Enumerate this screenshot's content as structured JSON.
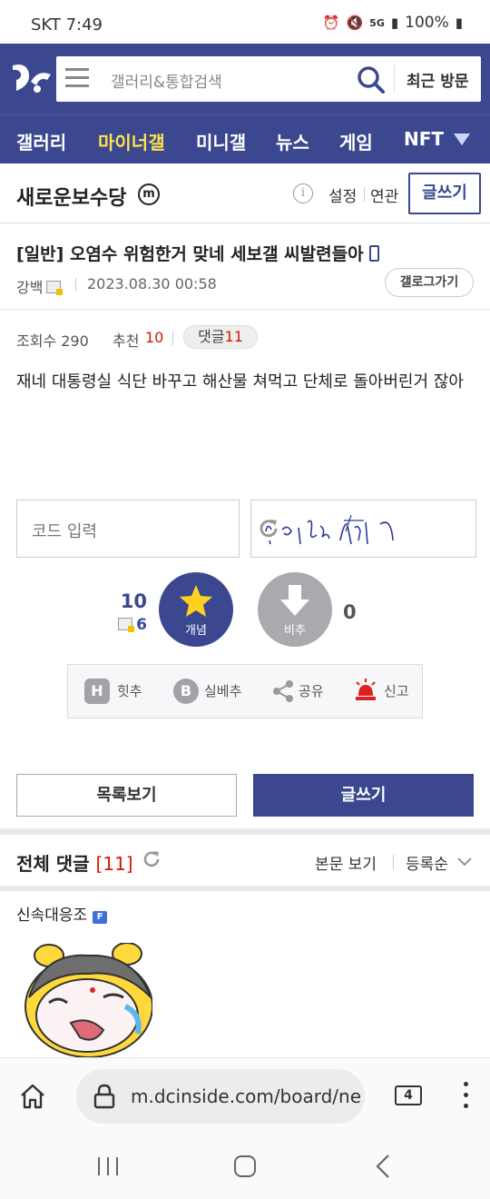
{
  "status": {
    "carrier": "SKT",
    "time": "7:49",
    "network": "5G",
    "battery": "100%"
  },
  "header": {
    "search_placeholder": "갤러리&통합검색",
    "recent_label": "최근 방문"
  },
  "nav": {
    "items": [
      "갤러리",
      "마이너갤",
      "미니갤",
      "뉴스",
      "게임",
      "NFT"
    ],
    "active_index": 1
  },
  "gallery": {
    "title": "새로운보수당",
    "badge": "m",
    "settings": "설정",
    "related": "연관",
    "write": "글쓰기"
  },
  "post": {
    "title": "[일반] 오염수 위험한거 맞네 세보갤 씨발련들아",
    "author": "강백",
    "date": "2023.08.30 00:58",
    "gallog": "갤로그가기",
    "views_label": "조회수 290",
    "recommend_label": "추천",
    "recommend_count": "10",
    "comment_label": "댓글",
    "comment_count": "11",
    "body": "재네 대통령실 식단 바꾸고 해산물 쳐먹고 단체로 돌아버린거 잖아"
  },
  "captcha": {
    "placeholder": "코드 입력"
  },
  "vote": {
    "up_count": "10",
    "fix_count": "6",
    "up_label": "개념",
    "down_label": "비추",
    "down_count": "0"
  },
  "share": {
    "hit": "힛추",
    "silbe": "실베추",
    "share": "공유",
    "report": "신고",
    "hit_glyph": "H",
    "silbe_glyph": "B"
  },
  "actions": {
    "list": "목록보기",
    "write": "글쓰기"
  },
  "comments": {
    "title": "전체 댓글",
    "count": "[11]",
    "view_body": "본문 보기",
    "order": "등록순",
    "first_user": "신속대응조",
    "fix_badge": "F"
  },
  "browser": {
    "url": "m.dcinside.com/board/ne",
    "tabs": "4"
  },
  "colors": {
    "brand": "#3b4890",
    "accent_yellow": "#ffe14d",
    "red": "#d31900"
  }
}
